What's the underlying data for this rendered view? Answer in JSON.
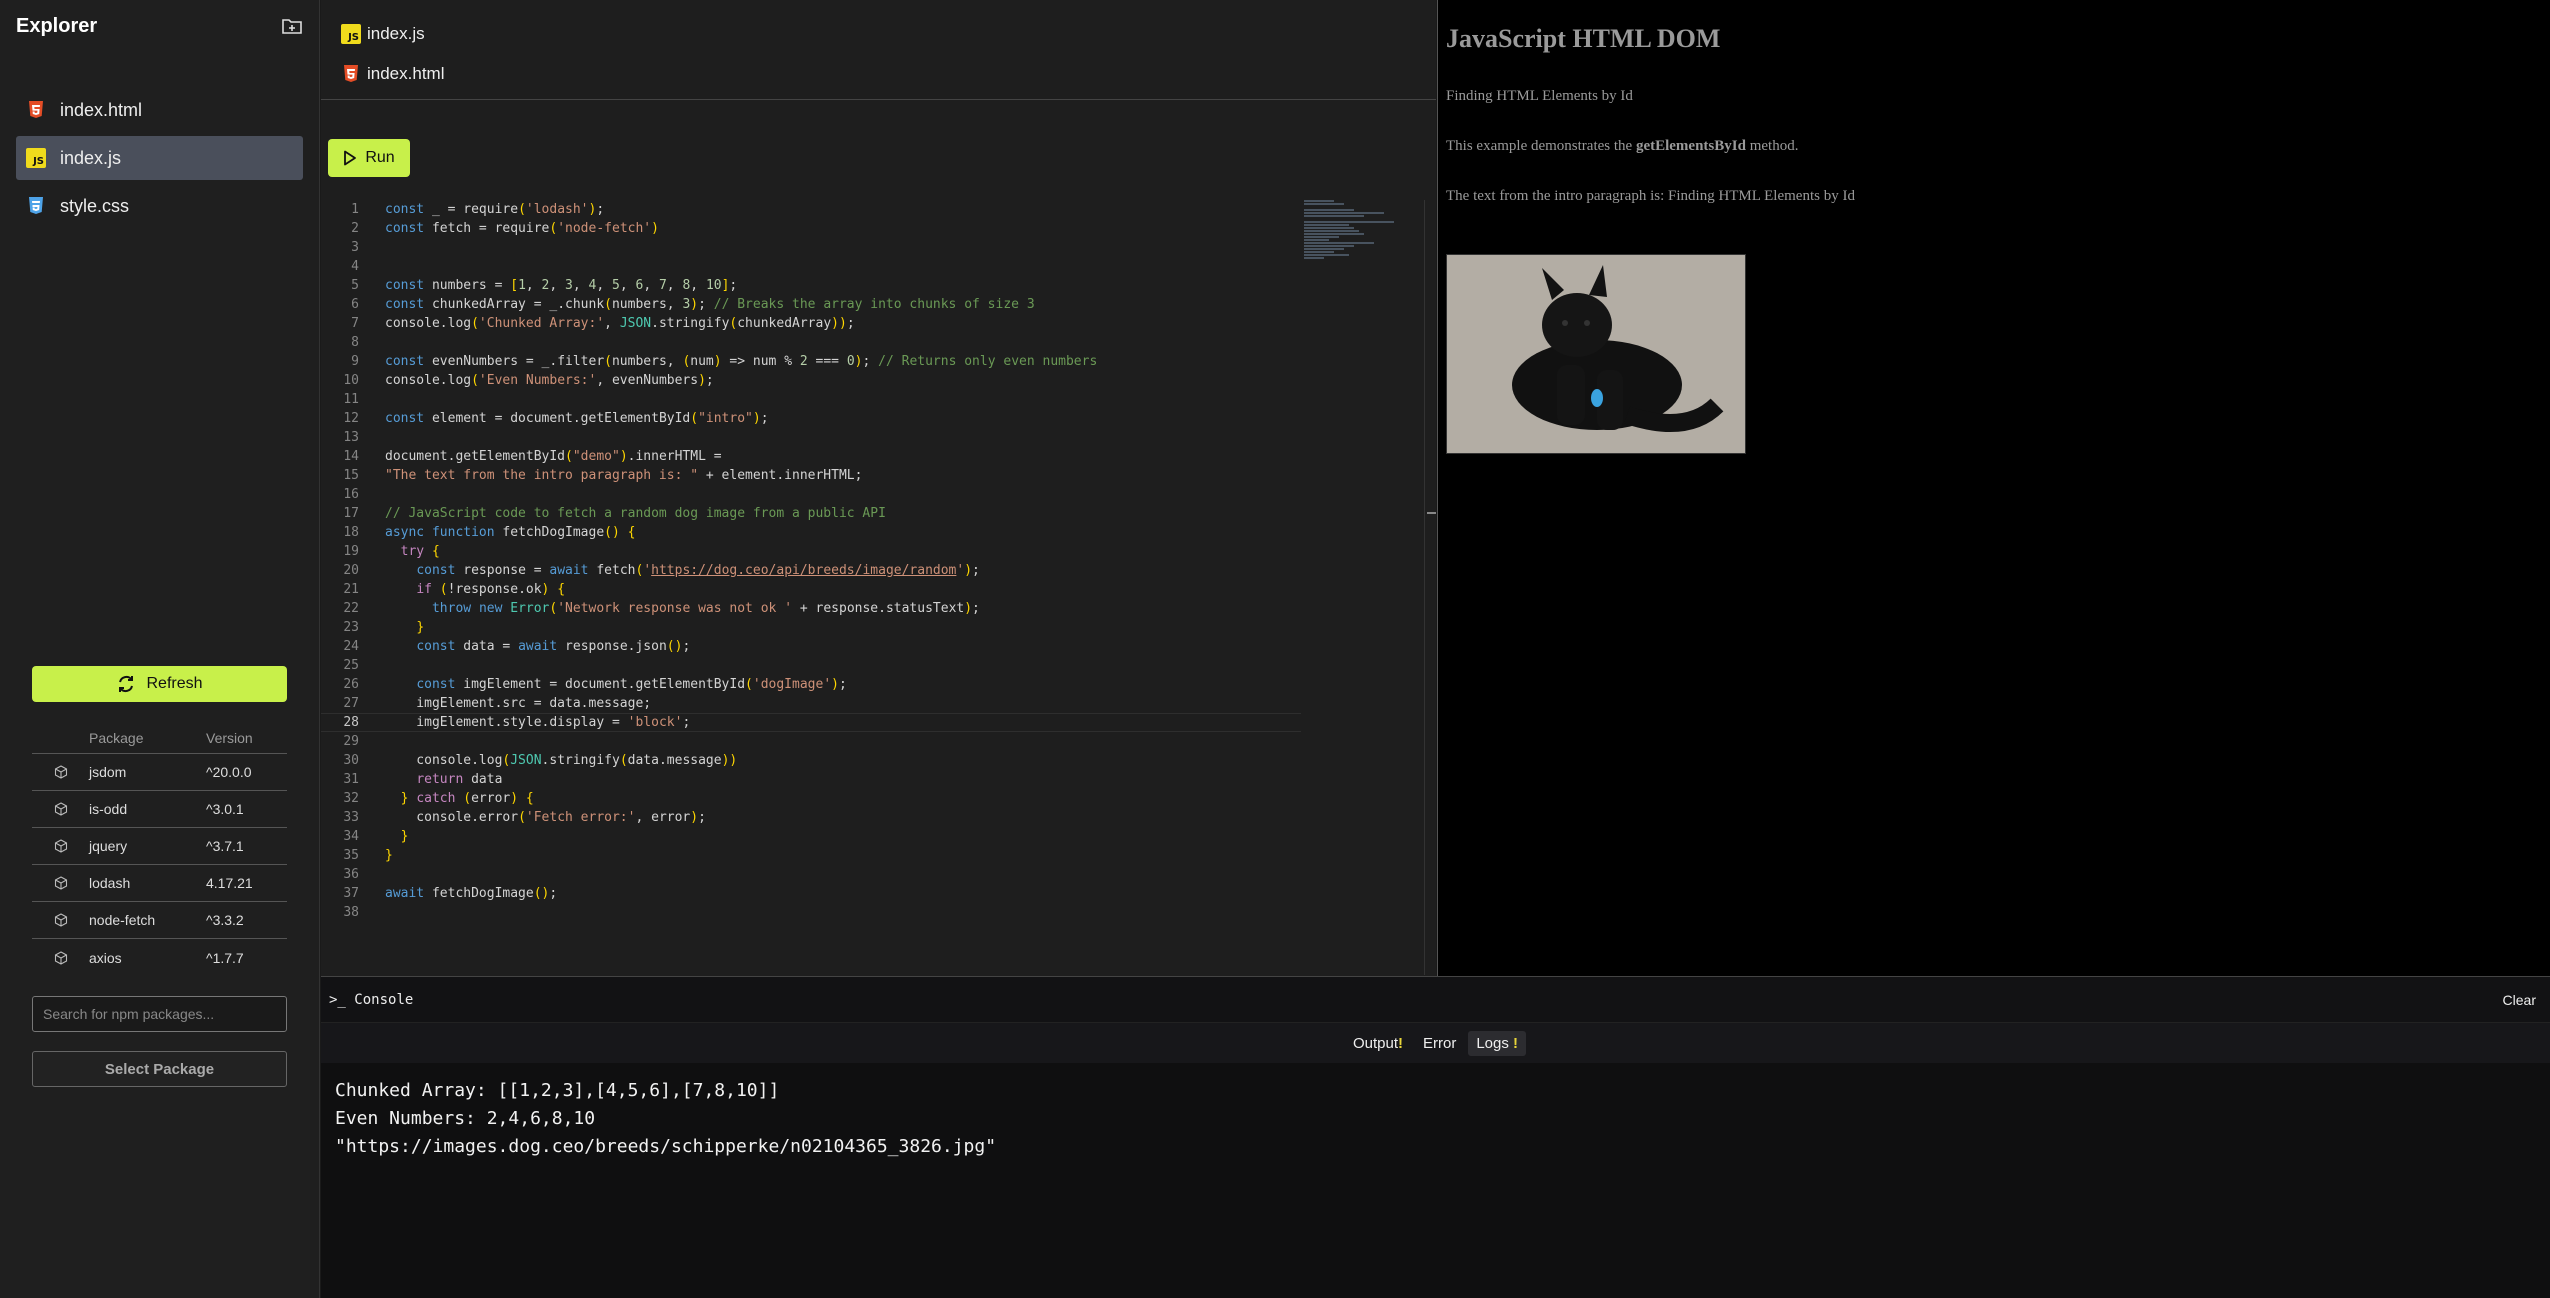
{
  "sidebar": {
    "title": "Explorer",
    "files": [
      {
        "name": "index.html",
        "icon": "html5-icon"
      },
      {
        "name": "index.js",
        "icon": "js-icon",
        "active": true
      },
      {
        "name": "style.css",
        "icon": "css3-icon"
      }
    ],
    "refresh_label": "Refresh",
    "packages_header": {
      "package": "Package",
      "version": "Version"
    },
    "packages": [
      {
        "name": "jsdom",
        "version": "^20.0.0"
      },
      {
        "name": "is-odd",
        "version": "^3.0.1"
      },
      {
        "name": "jquery",
        "version": "^3.7.1"
      },
      {
        "name": "lodash",
        "version": "4.17.21"
      },
      {
        "name": "node-fetch",
        "version": "^3.3.2"
      },
      {
        "name": "axios",
        "version": "^1.7.7"
      }
    ],
    "search_placeholder": "Search for npm packages...",
    "select_label": "Select Package"
  },
  "editor": {
    "tabs": [
      {
        "name": "index.js",
        "icon": "js-icon"
      },
      {
        "name": "index.html",
        "icon": "html5-icon"
      }
    ],
    "run_label": "Run",
    "js_badge": "JS",
    "line_numbers": [
      "1",
      "2",
      "3",
      "4",
      "5",
      "6",
      "7",
      "8",
      "9",
      "10",
      "11",
      "12",
      "13",
      "14",
      "15",
      "16",
      "17",
      "18",
      "19",
      "20",
      "21",
      "22",
      "23",
      "24",
      "25",
      "26",
      "27",
      "28",
      "29",
      "30",
      "31",
      "32",
      "33",
      "34",
      "35",
      "36",
      "37",
      "38"
    ],
    "code_lines": [
      "const _ = require('lodash');",
      "const fetch = require('node-fetch')",
      "",
      "",
      "const numbers = [1, 2, 3, 4, 5, 6, 7, 8, 10];",
      "const chunkedArray = _.chunk(numbers, 3); // Breaks the array into chunks of size 3",
      "console.log('Chunked Array:', JSON.stringify(chunkedArray));",
      "",
      "const evenNumbers = _.filter(numbers, (num) => num % 2 === 0); // Returns only even numbers",
      "console.log('Even Numbers:', evenNumbers);",
      "",
      "const element = document.getElementById(\"intro\");",
      "",
      "document.getElementById(\"demo\").innerHTML =",
      "\"The text from the intro paragraph is: \" + element.innerHTML;",
      "",
      "// JavaScript code to fetch a random dog image from a public API",
      "async function fetchDogImage() {",
      "  try {",
      "    const response = await fetch('https://dog.ceo/api/breeds/image/random');",
      "    if (!response.ok) {",
      "      throw new Error('Network response was not ok ' + response.statusText);",
      "    }",
      "    const data = await response.json();",
      "",
      "    const imgElement = document.getElementById('dogImage');",
      "    imgElement.src = data.message;",
      "    imgElement.style.display = 'block';",
      "",
      "    console.log(JSON.stringify(data.message))",
      "    return data",
      "  } catch (error) {",
      "    console.error('Fetch error:', error);",
      "  }",
      "}",
      "",
      "await fetchDogImage();",
      ""
    ],
    "active_line": 28
  },
  "preview": {
    "heading": "JavaScript HTML DOM",
    "intro": "Finding HTML Elements by Id",
    "method_prefix": "This example demonstrates the ",
    "method_name": "getElementsById",
    "method_suffix": " method.",
    "demo_text": "The text from the intro paragraph is: Finding HTML Elements by Id",
    "image_alt": "dog-photo"
  },
  "console": {
    "title": "Console",
    "prompt": ">_",
    "clear_label": "Clear",
    "tabs": [
      {
        "label": "Output",
        "marker": "!"
      },
      {
        "label": "Error",
        "marker": ""
      },
      {
        "label": "Logs",
        "marker": "!",
        "active": true
      }
    ],
    "output_lines": [
      "Chunked Array: [[1,2,3],[4,5,6],[7,8,10]]",
      "Even Numbers: 2,4,6,8,10",
      "\"https://images.dog.ceo/breeds/schipperke/n02104365_3826.jpg\""
    ]
  },
  "colors": {
    "accent": "#c8f04a",
    "js_yellow": "#f0db1c",
    "html_red": "#e44d26",
    "css_blue": "#4ea3e8"
  }
}
